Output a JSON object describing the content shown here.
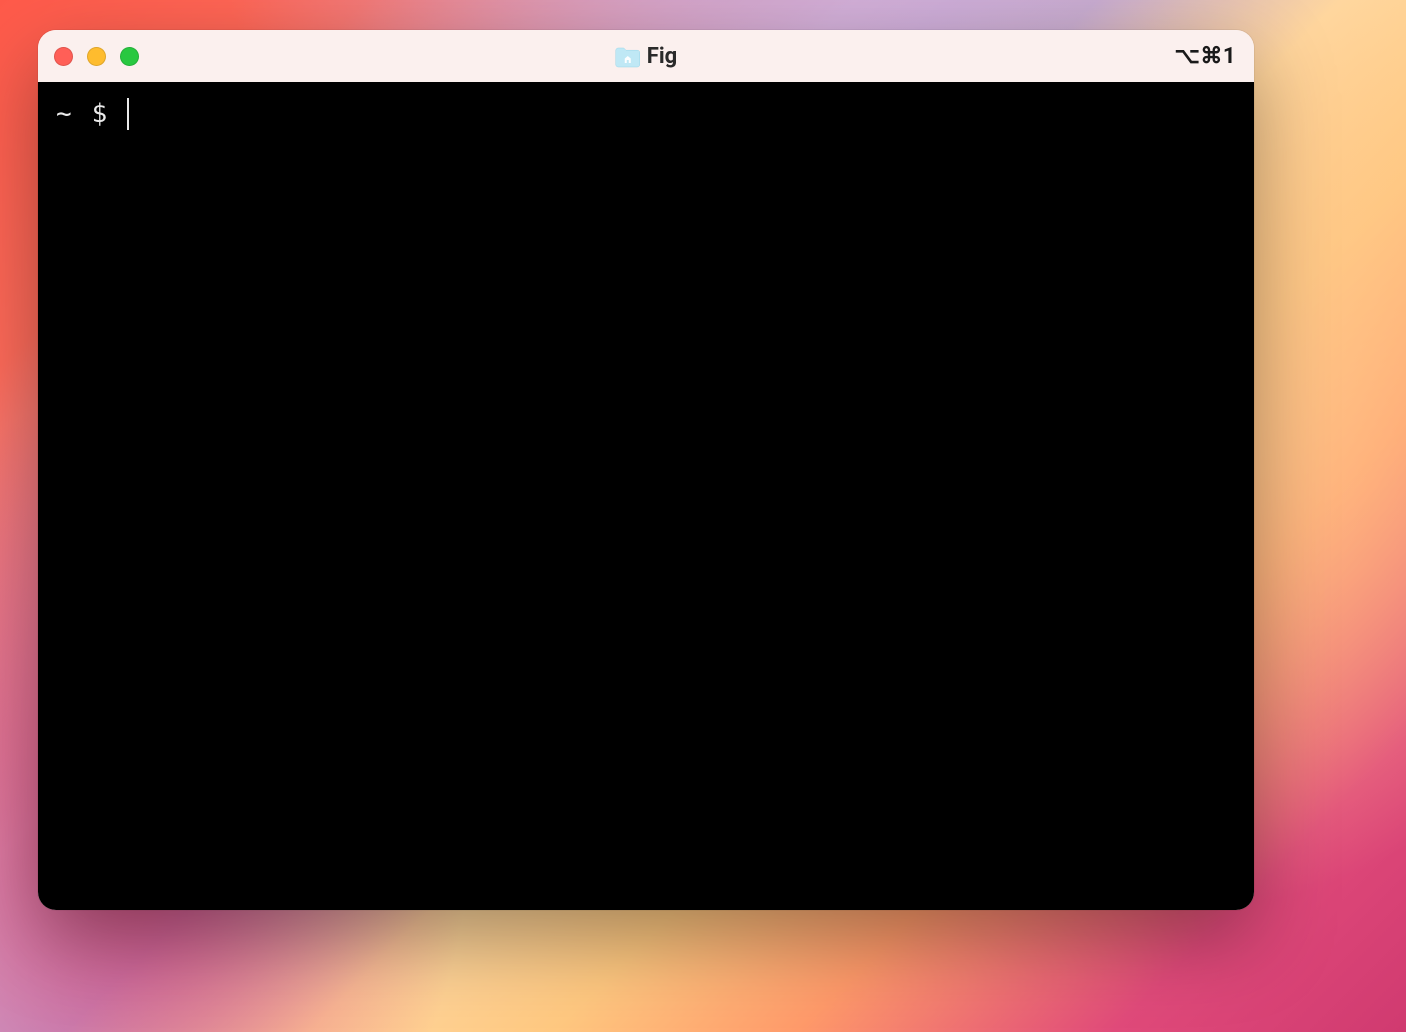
{
  "window": {
    "title": "Fig",
    "shortcut": "⌥⌘1"
  },
  "terminal": {
    "prompt_cwd": "~",
    "prompt_symbol": "$",
    "input": ""
  },
  "colors": {
    "titlebar_bg": "#fbf0ee",
    "terminal_bg": "#000000",
    "terminal_fg": "#eaeaea",
    "traffic_close": "#ff5f57",
    "traffic_minimize": "#febc2e",
    "traffic_zoom": "#28c840"
  },
  "icons": {
    "folder": "folder-home-icon"
  }
}
